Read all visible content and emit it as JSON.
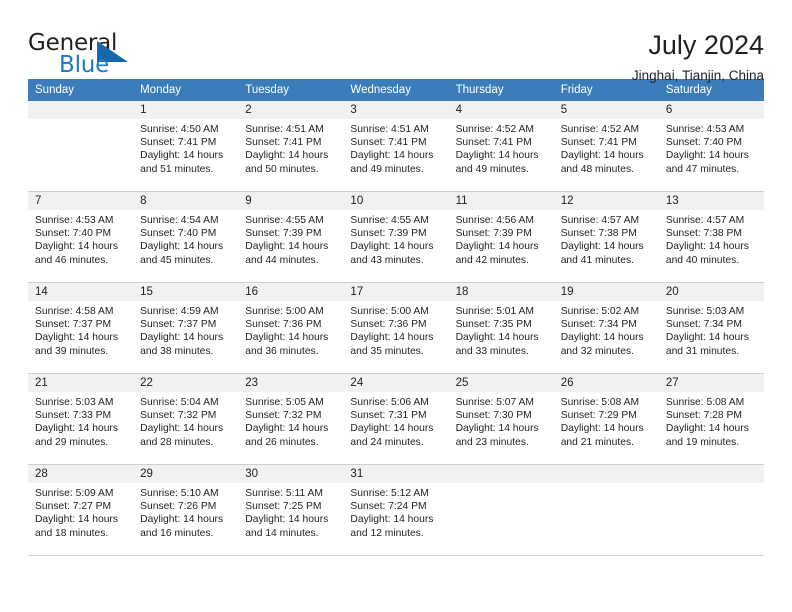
{
  "logo": {
    "word_top": "General",
    "word_bottom": "Blue",
    "accent_color": "#1668ad",
    "triangle_icon": "blue-triangle-icon"
  },
  "header": {
    "title": "July 2024",
    "subtitle": "Jinghai, Tianjin, China"
  },
  "calendar": {
    "header_color": "#3b7dba",
    "weekday_headers": [
      "Sunday",
      "Monday",
      "Tuesday",
      "Wednesday",
      "Thursday",
      "Friday",
      "Saturday"
    ],
    "weeks": [
      [
        {
          "day": "",
          "sunrise": "",
          "sunset": "",
          "daylight_line1": "",
          "daylight_line2": ""
        },
        {
          "day": "1",
          "sunrise": "Sunrise: 4:50 AM",
          "sunset": "Sunset: 7:41 PM",
          "daylight_line1": "Daylight: 14 hours",
          "daylight_line2": "and 51 minutes."
        },
        {
          "day": "2",
          "sunrise": "Sunrise: 4:51 AM",
          "sunset": "Sunset: 7:41 PM",
          "daylight_line1": "Daylight: 14 hours",
          "daylight_line2": "and 50 minutes."
        },
        {
          "day": "3",
          "sunrise": "Sunrise: 4:51 AM",
          "sunset": "Sunset: 7:41 PM",
          "daylight_line1": "Daylight: 14 hours",
          "daylight_line2": "and 49 minutes."
        },
        {
          "day": "4",
          "sunrise": "Sunrise: 4:52 AM",
          "sunset": "Sunset: 7:41 PM",
          "daylight_line1": "Daylight: 14 hours",
          "daylight_line2": "and 49 minutes."
        },
        {
          "day": "5",
          "sunrise": "Sunrise: 4:52 AM",
          "sunset": "Sunset: 7:41 PM",
          "daylight_line1": "Daylight: 14 hours",
          "daylight_line2": "and 48 minutes."
        },
        {
          "day": "6",
          "sunrise": "Sunrise: 4:53 AM",
          "sunset": "Sunset: 7:40 PM",
          "daylight_line1": "Daylight: 14 hours",
          "daylight_line2": "and 47 minutes."
        }
      ],
      [
        {
          "day": "7",
          "sunrise": "Sunrise: 4:53 AM",
          "sunset": "Sunset: 7:40 PM",
          "daylight_line1": "Daylight: 14 hours",
          "daylight_line2": "and 46 minutes."
        },
        {
          "day": "8",
          "sunrise": "Sunrise: 4:54 AM",
          "sunset": "Sunset: 7:40 PM",
          "daylight_line1": "Daylight: 14 hours",
          "daylight_line2": "and 45 minutes."
        },
        {
          "day": "9",
          "sunrise": "Sunrise: 4:55 AM",
          "sunset": "Sunset: 7:39 PM",
          "daylight_line1": "Daylight: 14 hours",
          "daylight_line2": "and 44 minutes."
        },
        {
          "day": "10",
          "sunrise": "Sunrise: 4:55 AM",
          "sunset": "Sunset: 7:39 PM",
          "daylight_line1": "Daylight: 14 hours",
          "daylight_line2": "and 43 minutes."
        },
        {
          "day": "11",
          "sunrise": "Sunrise: 4:56 AM",
          "sunset": "Sunset: 7:39 PM",
          "daylight_line1": "Daylight: 14 hours",
          "daylight_line2": "and 42 minutes."
        },
        {
          "day": "12",
          "sunrise": "Sunrise: 4:57 AM",
          "sunset": "Sunset: 7:38 PM",
          "daylight_line1": "Daylight: 14 hours",
          "daylight_line2": "and 41 minutes."
        },
        {
          "day": "13",
          "sunrise": "Sunrise: 4:57 AM",
          "sunset": "Sunset: 7:38 PM",
          "daylight_line1": "Daylight: 14 hours",
          "daylight_line2": "and 40 minutes."
        }
      ],
      [
        {
          "day": "14",
          "sunrise": "Sunrise: 4:58 AM",
          "sunset": "Sunset: 7:37 PM",
          "daylight_line1": "Daylight: 14 hours",
          "daylight_line2": "and 39 minutes."
        },
        {
          "day": "15",
          "sunrise": "Sunrise: 4:59 AM",
          "sunset": "Sunset: 7:37 PM",
          "daylight_line1": "Daylight: 14 hours",
          "daylight_line2": "and 38 minutes."
        },
        {
          "day": "16",
          "sunrise": "Sunrise: 5:00 AM",
          "sunset": "Sunset: 7:36 PM",
          "daylight_line1": "Daylight: 14 hours",
          "daylight_line2": "and 36 minutes."
        },
        {
          "day": "17",
          "sunrise": "Sunrise: 5:00 AM",
          "sunset": "Sunset: 7:36 PM",
          "daylight_line1": "Daylight: 14 hours",
          "daylight_line2": "and 35 minutes."
        },
        {
          "day": "18",
          "sunrise": "Sunrise: 5:01 AM",
          "sunset": "Sunset: 7:35 PM",
          "daylight_line1": "Daylight: 14 hours",
          "daylight_line2": "and 33 minutes."
        },
        {
          "day": "19",
          "sunrise": "Sunrise: 5:02 AM",
          "sunset": "Sunset: 7:34 PM",
          "daylight_line1": "Daylight: 14 hours",
          "daylight_line2": "and 32 minutes."
        },
        {
          "day": "20",
          "sunrise": "Sunrise: 5:03 AM",
          "sunset": "Sunset: 7:34 PM",
          "daylight_line1": "Daylight: 14 hours",
          "daylight_line2": "and 31 minutes."
        }
      ],
      [
        {
          "day": "21",
          "sunrise": "Sunrise: 5:03 AM",
          "sunset": "Sunset: 7:33 PM",
          "daylight_line1": "Daylight: 14 hours",
          "daylight_line2": "and 29 minutes."
        },
        {
          "day": "22",
          "sunrise": "Sunrise: 5:04 AM",
          "sunset": "Sunset: 7:32 PM",
          "daylight_line1": "Daylight: 14 hours",
          "daylight_line2": "and 28 minutes."
        },
        {
          "day": "23",
          "sunrise": "Sunrise: 5:05 AM",
          "sunset": "Sunset: 7:32 PM",
          "daylight_line1": "Daylight: 14 hours",
          "daylight_line2": "and 26 minutes."
        },
        {
          "day": "24",
          "sunrise": "Sunrise: 5:06 AM",
          "sunset": "Sunset: 7:31 PM",
          "daylight_line1": "Daylight: 14 hours",
          "daylight_line2": "and 24 minutes."
        },
        {
          "day": "25",
          "sunrise": "Sunrise: 5:07 AM",
          "sunset": "Sunset: 7:30 PM",
          "daylight_line1": "Daylight: 14 hours",
          "daylight_line2": "and 23 minutes."
        },
        {
          "day": "26",
          "sunrise": "Sunrise: 5:08 AM",
          "sunset": "Sunset: 7:29 PM",
          "daylight_line1": "Daylight: 14 hours",
          "daylight_line2": "and 21 minutes."
        },
        {
          "day": "27",
          "sunrise": "Sunrise: 5:08 AM",
          "sunset": "Sunset: 7:28 PM",
          "daylight_line1": "Daylight: 14 hours",
          "daylight_line2": "and 19 minutes."
        }
      ],
      [
        {
          "day": "28",
          "sunrise": "Sunrise: 5:09 AM",
          "sunset": "Sunset: 7:27 PM",
          "daylight_line1": "Daylight: 14 hours",
          "daylight_line2": "and 18 minutes."
        },
        {
          "day": "29",
          "sunrise": "Sunrise: 5:10 AM",
          "sunset": "Sunset: 7:26 PM",
          "daylight_line1": "Daylight: 14 hours",
          "daylight_line2": "and 16 minutes."
        },
        {
          "day": "30",
          "sunrise": "Sunrise: 5:11 AM",
          "sunset": "Sunset: 7:25 PM",
          "daylight_line1": "Daylight: 14 hours",
          "daylight_line2": "and 14 minutes."
        },
        {
          "day": "31",
          "sunrise": "Sunrise: 5:12 AM",
          "sunset": "Sunset: 7:24 PM",
          "daylight_line1": "Daylight: 14 hours",
          "daylight_line2": "and 12 minutes."
        },
        {
          "day": "",
          "sunrise": "",
          "sunset": "",
          "daylight_line1": "",
          "daylight_line2": ""
        },
        {
          "day": "",
          "sunrise": "",
          "sunset": "",
          "daylight_line1": "",
          "daylight_line2": ""
        },
        {
          "day": "",
          "sunrise": "",
          "sunset": "",
          "daylight_line1": "",
          "daylight_line2": ""
        }
      ]
    ]
  }
}
